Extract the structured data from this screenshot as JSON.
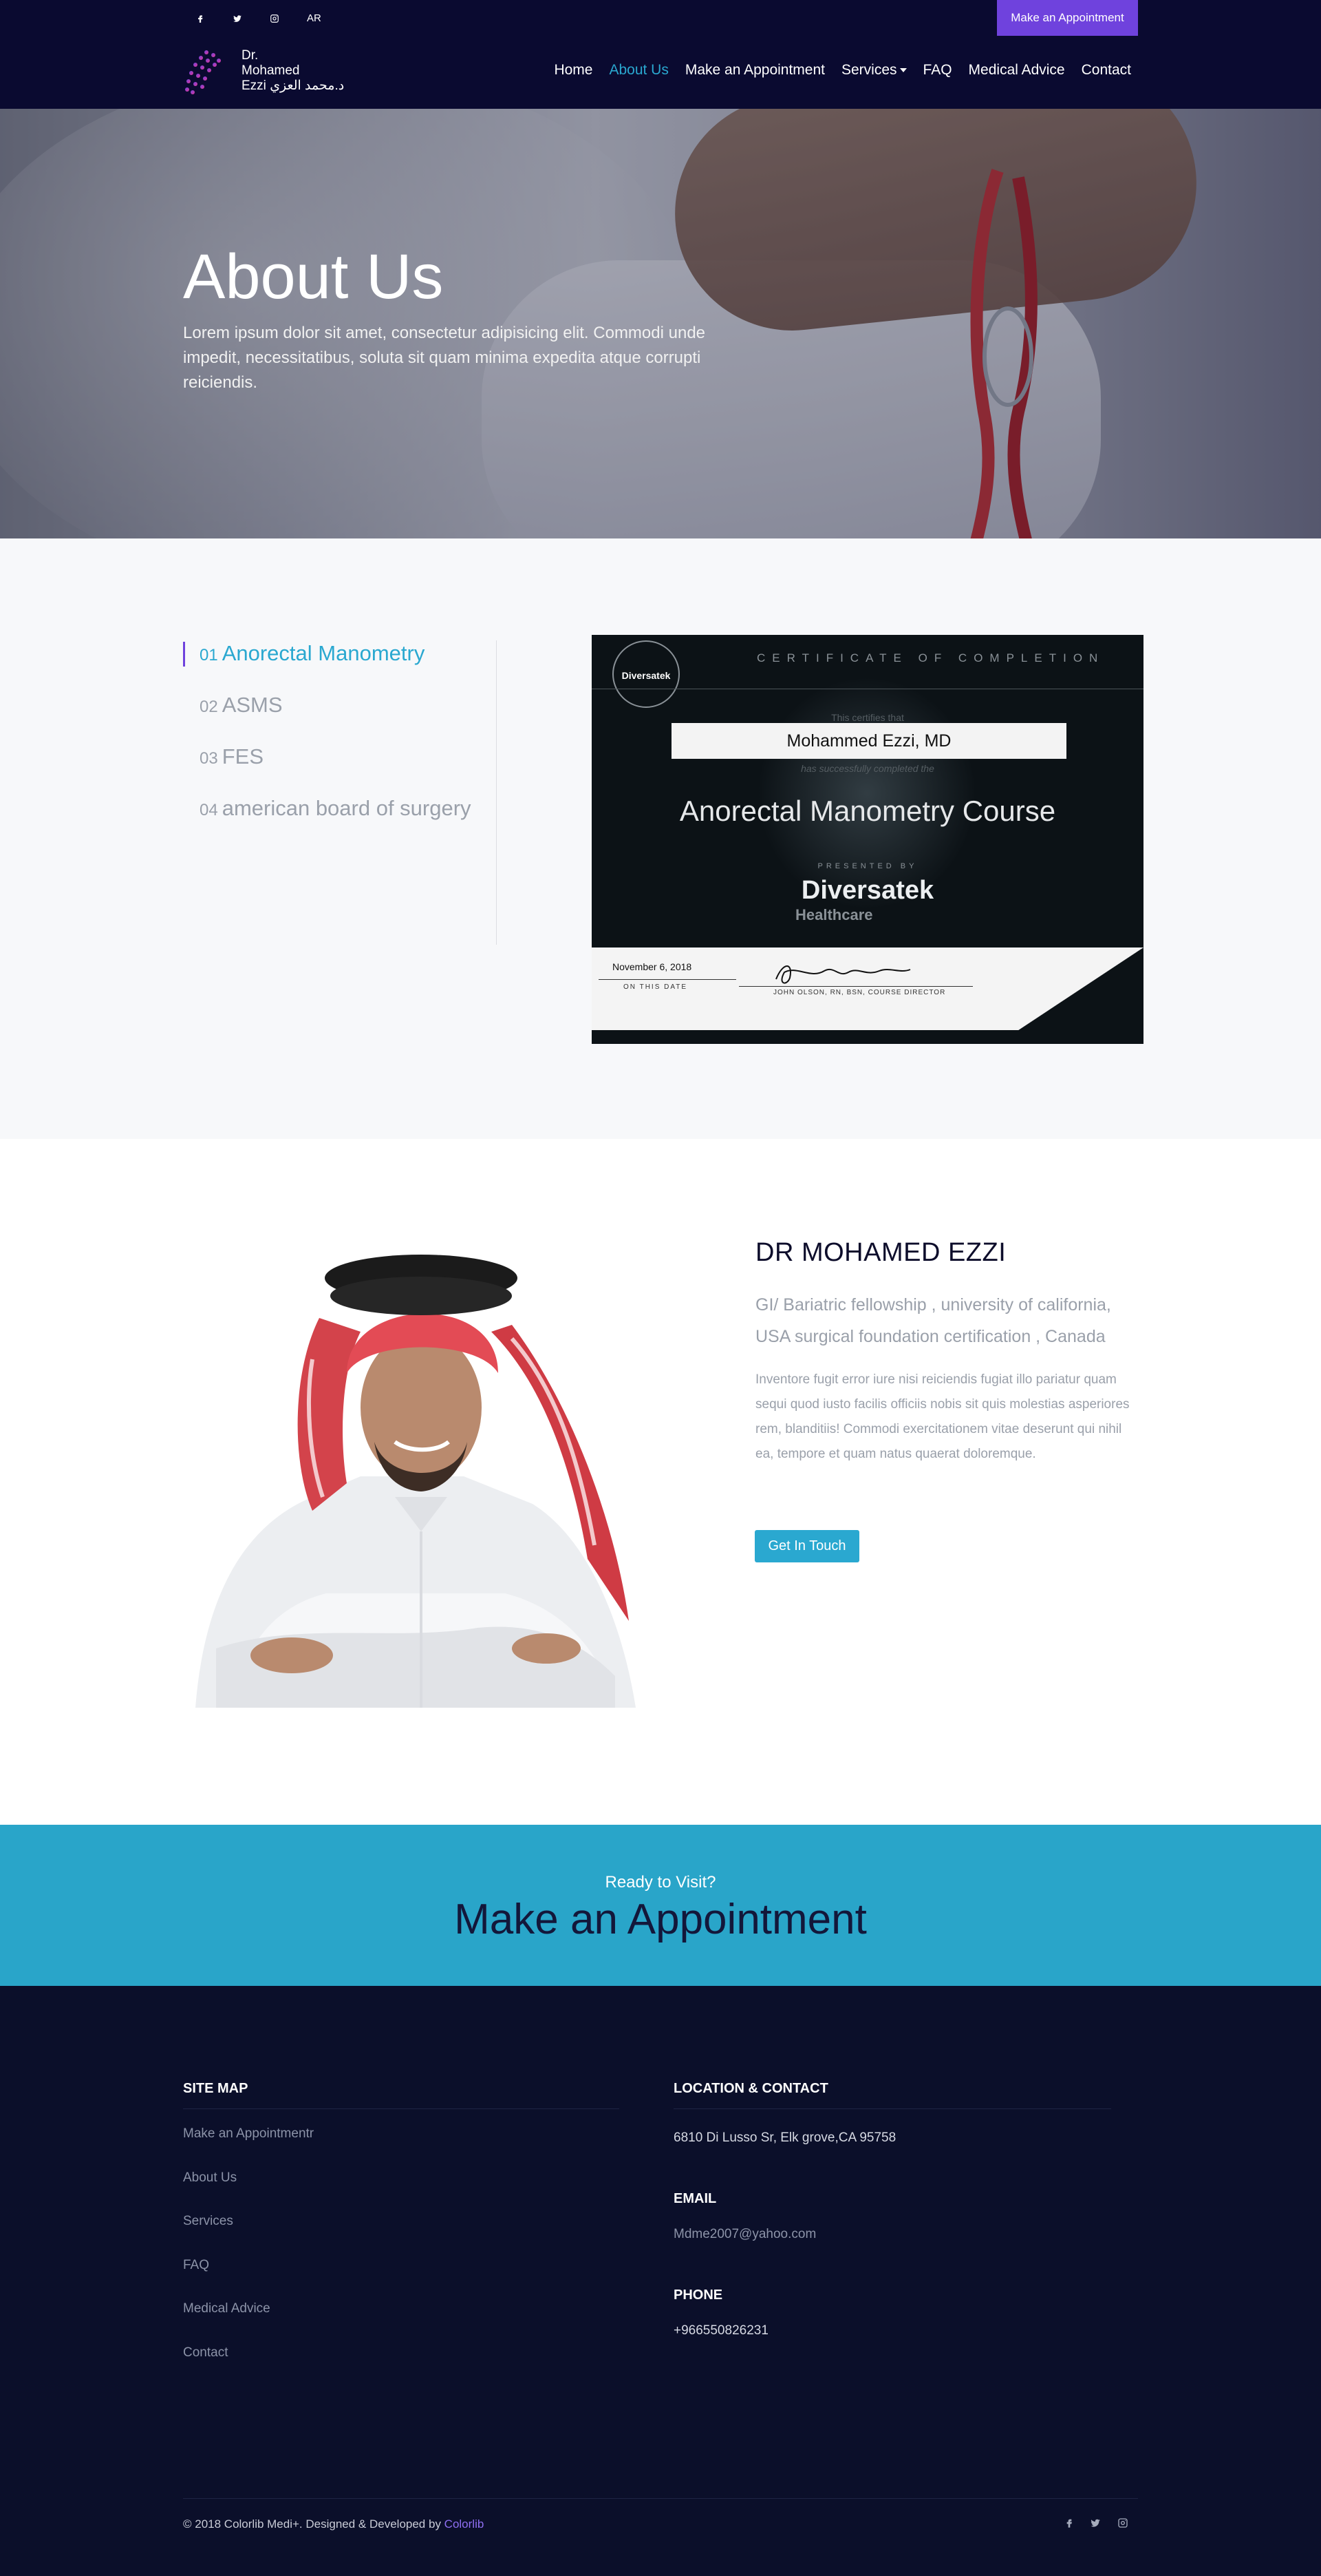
{
  "topbar": {
    "social": [
      {
        "icon": "facebook-icon"
      },
      {
        "icon": "twitter-icon"
      },
      {
        "icon": "instagram-icon"
      }
    ],
    "language": "AR",
    "cta_label": "Make an Appointment",
    "cta_color": "#6f42dd"
  },
  "logo": {
    "line1": "Dr.",
    "line2": "Mohamed",
    "line3": "Ezzi",
    "arabic": "د.محمد العزي"
  },
  "nav": {
    "items": [
      {
        "label": "Home",
        "active": false
      },
      {
        "label": "About Us",
        "active": true
      },
      {
        "label": "Make an Appointment",
        "active": false
      },
      {
        "label": "Services",
        "active": false,
        "dropdown": true
      },
      {
        "label": "FAQ",
        "active": false
      },
      {
        "label": "Medical Advice",
        "active": false
      },
      {
        "label": "Contact",
        "active": false
      }
    ],
    "active_color": "#2aa8d0"
  },
  "hero": {
    "title": "About Us",
    "text": "Lorem ipsum dolor sit amet, consectetur adipisicing elit. Commodi unde impedit, necessitatibus, soluta sit quam minima expedita atque corrupti reiciendis."
  },
  "certificates": {
    "tabs": [
      {
        "num": "01",
        "label": "Anorectal Manometry",
        "active": true
      },
      {
        "num": "02",
        "label": "ASMS",
        "active": false
      },
      {
        "num": "03",
        "label": "FES",
        "active": false
      },
      {
        "num": "04",
        "label": "american board of surgery",
        "active": false
      }
    ],
    "document": {
      "seal": "Diversatek",
      "heading": "CERTIFICATE OF COMPLETION",
      "awarded": "This certifies that",
      "name": "Mohammed Ezzi, MD",
      "completed": "has successfully completed the",
      "course": "Anorectal Manometry Course",
      "presented_by": "PRESENTED BY",
      "brand": "Diversatek",
      "brand_sub": "Healthcare",
      "date": "November 6, 2018",
      "date_label": "ON THIS DATE",
      "signer": "JOHN OLSON, RN, BSN, COURSE DIRECTOR"
    }
  },
  "doctor": {
    "name": "DR MOHAMED EZZI",
    "credentials": "GI/ Bariatric fellowship , university of california, USA surgical foundation certification , Canada",
    "bio": "Inventore fugit error iure nisi reiciendis fugiat illo pariatur quam sequi quod iusto facilis officiis nobis sit quis molestias asperiores rem, blanditiis! Commodi exercitationem vitae deserunt qui nihil ea, tempore et quam natus quaerat doloremque.",
    "button": "Get In Touch"
  },
  "cta": {
    "kicker": "Ready to Visit?",
    "title": "Make an Appointment"
  },
  "footer": {
    "sitemap_heading": "SITE MAP",
    "sitemap": [
      {
        "label": "Make an Appointmentr"
      },
      {
        "label": "About Us"
      },
      {
        "label": "Services"
      },
      {
        "label": "FAQ"
      },
      {
        "label": "Medical Advice"
      },
      {
        "label": "Contact"
      }
    ],
    "contact_heading": "LOCATION & CONTACT",
    "address": "6810 Di Lusso Sr, Elk grove,CA 95758",
    "email_label": "EMAIL",
    "email": "Mdme2007@yahoo.com",
    "phone_label": "PHONE",
    "phone": "+966550826231",
    "copyright_text": "© 2018 Colorlib Medi+. Designed & Developed by ",
    "copyright_link": "Colorlib"
  }
}
